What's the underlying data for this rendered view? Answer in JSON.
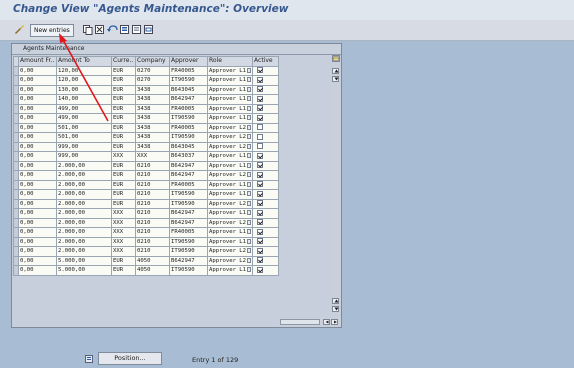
{
  "title": "Change View \"Agents Maintenance\": Overview",
  "toolbar": {
    "new_entries_label": "New entries"
  },
  "panel": {
    "title": "Agents Maintenance"
  },
  "columns": [
    "Amount Fr..",
    "Amount To",
    "Curre..",
    "Company",
    "Approver",
    "Role",
    "Active"
  ],
  "rows": [
    {
      "from": "0,00",
      "to": "120,00",
      "cur": "EUR",
      "company": "0270",
      "approver": "FR40005",
      "role": "Approver L1",
      "active": true
    },
    {
      "from": "0,00",
      "to": "120,00",
      "cur": "EUR",
      "company": "0270",
      "approver": "IT90590",
      "role": "Approver L1",
      "active": true
    },
    {
      "from": "0,00",
      "to": "130,00",
      "cur": "EUR",
      "company": "3438",
      "approver": "B643045",
      "role": "Approver L1",
      "active": true
    },
    {
      "from": "0,00",
      "to": "140,00",
      "cur": "EUR",
      "company": "3438",
      "approver": "B642947",
      "role": "Approver L1",
      "active": true
    },
    {
      "from": "0,00",
      "to": "499,00",
      "cur": "EUR",
      "company": "3438",
      "approver": "FR40005",
      "role": "Approver L1",
      "active": true
    },
    {
      "from": "0,00",
      "to": "499,00",
      "cur": "EUR",
      "company": "3438",
      "approver": "IT90590",
      "role": "Approver L1",
      "active": true
    },
    {
      "from": "0,00",
      "to": "501,00",
      "cur": "EUR",
      "company": "3438",
      "approver": "FR40005",
      "role": "Approver L2",
      "active": false
    },
    {
      "from": "0,00",
      "to": "501,00",
      "cur": "EUR",
      "company": "3438",
      "approver": "IT90590",
      "role": "Approver L2",
      "active": false
    },
    {
      "from": "0,00",
      "to": "999,00",
      "cur": "EUR",
      "company": "3438",
      "approver": "B643045",
      "role": "Approver L2",
      "active": false
    },
    {
      "from": "0,00",
      "to": "999,00",
      "cur": "XXX",
      "company": "XXX",
      "approver": "B643037",
      "role": "Approver L1",
      "active": true
    },
    {
      "from": "0,00",
      "to": "2.000,00",
      "cur": "EUR",
      "company": "0210",
      "approver": "B642947",
      "role": "Approver L1",
      "active": true
    },
    {
      "from": "0,00",
      "to": "2.000,00",
      "cur": "EUR",
      "company": "0210",
      "approver": "B642947",
      "role": "Approver L2",
      "active": true
    },
    {
      "from": "0,00",
      "to": "2.000,00",
      "cur": "EUR",
      "company": "0210",
      "approver": "FR40005",
      "role": "Approver L1",
      "active": true
    },
    {
      "from": "0,00",
      "to": "2.000,00",
      "cur": "EUR",
      "company": "0210",
      "approver": "IT90590",
      "role": "Approver L1",
      "active": true
    },
    {
      "from": "0,00",
      "to": "2.000,00",
      "cur": "EUR",
      "company": "0210",
      "approver": "IT90590",
      "role": "Approver L2",
      "active": true
    },
    {
      "from": "0,00",
      "to": "2.000,00",
      "cur": "XXX",
      "company": "0210",
      "approver": "B642947",
      "role": "Approver L1",
      "active": true
    },
    {
      "from": "0,00",
      "to": "2.000,00",
      "cur": "XXX",
      "company": "0210",
      "approver": "B642947",
      "role": "Approver L2",
      "active": true
    },
    {
      "from": "0,00",
      "to": "2.000,00",
      "cur": "XXX",
      "company": "0210",
      "approver": "FR40005",
      "role": "Approver L1",
      "active": true
    },
    {
      "from": "0,00",
      "to": "2.000,00",
      "cur": "XXX",
      "company": "0210",
      "approver": "IT90590",
      "role": "Approver L1",
      "active": true
    },
    {
      "from": "0,00",
      "to": "2.000,00",
      "cur": "XXX",
      "company": "0210",
      "approver": "IT90590",
      "role": "Approver L2",
      "active": true
    },
    {
      "from": "0,00",
      "to": "5.000,00",
      "cur": "EUR",
      "company": "4050",
      "approver": "B642947",
      "role": "Approver L2",
      "active": true
    },
    {
      "from": "0,00",
      "to": "5.000,00",
      "cur": "EUR",
      "company": "4050",
      "approver": "IT90590",
      "role": "Approver L1",
      "active": true
    }
  ],
  "footer": {
    "position_label": "Position...",
    "entry_text": "Entry 1 of 129"
  },
  "colors": {
    "background": "#a8bdd3",
    "title_text": "#36588f",
    "arrow": "#e0181e"
  },
  "icons": [
    "new-entries-icon",
    "copy-icon",
    "delete-icon",
    "undo-icon",
    "select-all-icon",
    "deselect-all-icon",
    "select-block-icon",
    "table-settings-icon",
    "position-icon"
  ]
}
